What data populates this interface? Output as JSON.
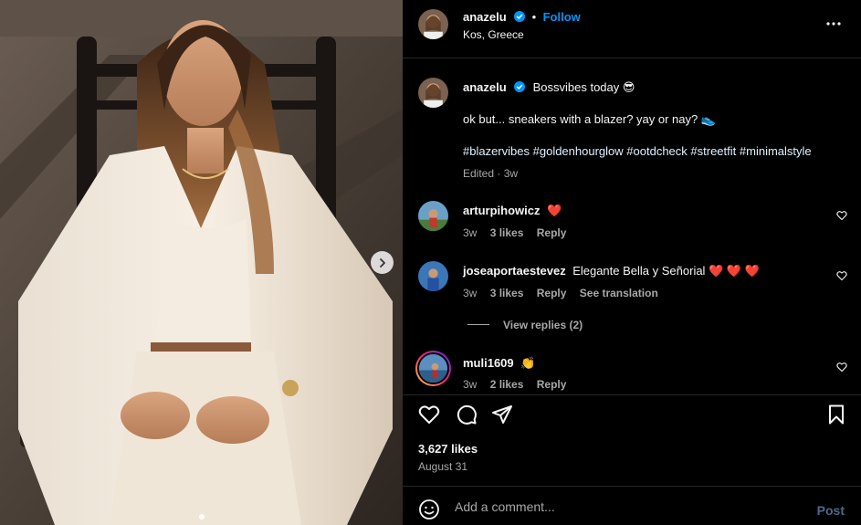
{
  "post": {
    "author": "anazelu",
    "follow_label": "Follow",
    "follow_separator": "•",
    "location": "Kos, Greece",
    "caption_text": "Bossvibes today 😎",
    "caption_line2": "ok but... sneakers with a blazer? yay or nay? 👟",
    "hashtags": [
      "#blazervibes",
      "#goldenhourglow",
      "#ootdcheck",
      "#streetfit",
      "#minimalstyle"
    ],
    "edited_label": "Edited",
    "edited_sep": "·",
    "caption_age": "3w"
  },
  "comments": [
    {
      "user": "arturpihowicz",
      "text": "❤️",
      "age": "3w",
      "likes": "3 likes",
      "reply": "Reply",
      "translation": ""
    },
    {
      "user": "joseaportaestevez",
      "text": "Elegante Bella y Señorial ❤️ ❤️ ❤️",
      "age": "3w",
      "likes": "3 likes",
      "reply": "Reply",
      "translation": "See translation"
    },
    {
      "user": "muli1609",
      "text": "👏",
      "age": "3w",
      "likes": "2 likes",
      "reply": "Reply",
      "translation": ""
    }
  ],
  "view_replies": "View replies (2)",
  "stats": {
    "likes": "3,627 likes",
    "date": "August 31"
  },
  "composer": {
    "placeholder": "Add a comment...",
    "post_label": "Post"
  },
  "colors": {
    "background": "#000000",
    "accent": "#0095f6",
    "hashtag": "#6e9cff",
    "muted": "#a8a8a8",
    "heart_red": "#ff3040"
  },
  "icons": [
    "more-options-icon",
    "verified-badge-icon",
    "heart-icon",
    "comment-icon",
    "share-icon",
    "bookmark-icon",
    "emoji-icon",
    "chevron-right-icon"
  ],
  "carousel": {
    "slides": 1,
    "current": 1
  }
}
